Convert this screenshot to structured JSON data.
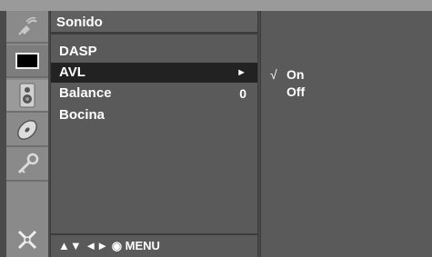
{
  "menu": {
    "title": "Sonido",
    "items": [
      {
        "label": "DASP",
        "value": ""
      },
      {
        "label": "AVL",
        "value": "►"
      },
      {
        "label": "Balance",
        "value": "0"
      },
      {
        "label": "Bocina",
        "value": ""
      }
    ],
    "selected_index": 1,
    "footer": "▲▼ ◄► ◉ MENU"
  },
  "options": {
    "items": [
      {
        "check": "√",
        "label": "On"
      },
      {
        "check": "",
        "label": "Off"
      }
    ]
  },
  "sidebar": {
    "icons": [
      "satellite-icon",
      "screen-icon",
      "speaker-icon",
      "disc-icon",
      "key-icon",
      "tools-icon"
    ]
  },
  "colors": {
    "background": "#4a4a4a",
    "panel": "#5a5a5a",
    "highlight": "#222222",
    "text": "#ffffff"
  }
}
